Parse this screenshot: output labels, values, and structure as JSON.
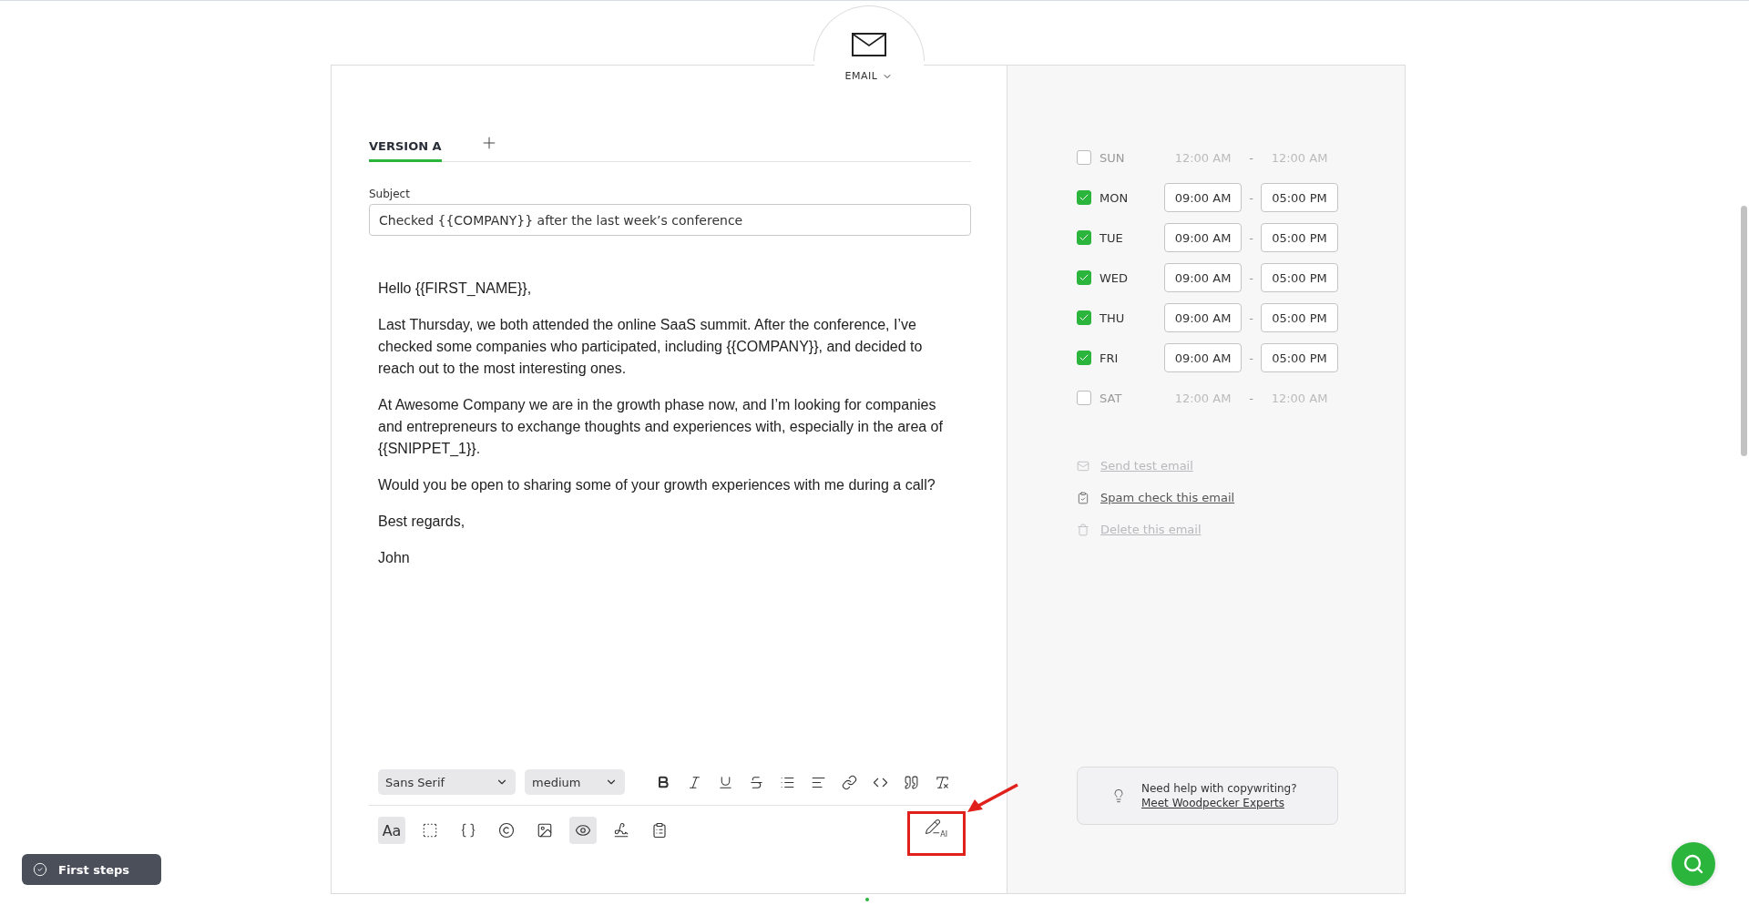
{
  "channel": {
    "label": "EMAIL"
  },
  "versions": [
    {
      "label": "VERSION A",
      "selected": true
    }
  ],
  "subject": {
    "label": "Subject",
    "value": "Checked {{COMPANY}} after the last week’s conference"
  },
  "body": [
    "Hello {{FIRST_NAME}},",
    "Last Thursday, we both attended the online SaaS summit. After the conference, I’ve checked some companies who participated, including {{COMPANY}}, and decided to reach out to the most interesting ones.",
    "At Awesome Company we are in the growth phase now, and I’m looking for companies and entrepreneurs to exchange thoughts and experiences with, especially in the area of {{SNIPPET_1}}.",
    "Would you be open to sharing some of your growth experiences with me during a call?",
    "Best regards,",
    "John"
  ],
  "toolbar": {
    "font": "Sans Serif",
    "size": "medium",
    "format_tools": [
      {
        "kind": "bold"
      },
      {
        "kind": "italic"
      },
      {
        "kind": "underline"
      },
      {
        "kind": "strike"
      },
      {
        "kind": "list"
      },
      {
        "kind": "align"
      },
      {
        "kind": "link"
      },
      {
        "kind": "code"
      },
      {
        "kind": "quote"
      },
      {
        "kind": "clear"
      }
    ],
    "insert_tools": [
      {
        "kind": "text",
        "label": "Aa",
        "active": true
      },
      {
        "kind": "template",
        "active": false
      },
      {
        "kind": "variable",
        "active": false
      },
      {
        "kind": "spin",
        "active": false
      },
      {
        "kind": "image",
        "active": false
      },
      {
        "kind": "preview",
        "active": true
      },
      {
        "kind": "signature",
        "active": false
      },
      {
        "kind": "check",
        "active": false
      }
    ],
    "ai_label": "AI"
  },
  "schedule": [
    {
      "day": "SUN",
      "checked": false,
      "from": "12:00 AM",
      "separator": "-",
      "to": "12:00 AM"
    },
    {
      "day": "MON",
      "checked": true,
      "from": "09:00 AM",
      "separator": "-",
      "to": "05:00 PM"
    },
    {
      "day": "TUE",
      "checked": true,
      "from": "09:00 AM",
      "separator": "-",
      "to": "05:00 PM"
    },
    {
      "day": "WED",
      "checked": true,
      "from": "09:00 AM",
      "separator": "-",
      "to": "05:00 PM"
    },
    {
      "day": "THU",
      "checked": true,
      "from": "09:00 AM",
      "separator": "-",
      "to": "05:00 PM"
    },
    {
      "day": "FRI",
      "checked": true,
      "from": "09:00 AM",
      "separator": "-",
      "to": "05:00 PM"
    },
    {
      "day": "SAT",
      "checked": false,
      "from": "12:00 AM",
      "separator": "-",
      "to": "12:00 AM"
    }
  ],
  "actions": [
    {
      "kind": "test",
      "label": "Send test email",
      "disabled": true
    },
    {
      "kind": "spam",
      "label": "Spam check this email",
      "disabled": false
    },
    {
      "kind": "delete",
      "label": "Delete this email",
      "disabled": true
    }
  ],
  "help": {
    "text": "Need help with copywriting?",
    "link": "Meet Woodpecker Experts"
  },
  "first_steps": {
    "label": "First steps"
  }
}
